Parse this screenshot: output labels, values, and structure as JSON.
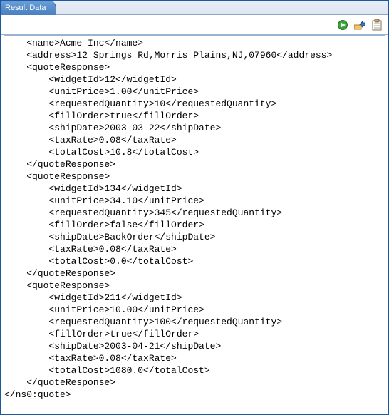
{
  "tab": {
    "title": "Result Data"
  },
  "toolbar": {
    "run": "run-icon",
    "export": "export-icon",
    "copy": "copy-icon"
  },
  "xml": {
    "indent1": "    ",
    "indent2": "        ",
    "name_open": "<name>",
    "name_val": "Acme Inc",
    "name_close": "</name>",
    "address_open": "<address>",
    "address_val": "12 Springs Rd,Morris Plains,NJ,07960",
    "address_close": "</address>",
    "qr_open": "<quoteResponse>",
    "qr_close": "</quoteResponse>",
    "widgetId_open": "<widgetId>",
    "widgetId_close": "</widgetId>",
    "unitPrice_open": "<unitPrice>",
    "unitPrice_close": "</unitPrice>",
    "reqQty_open": "<requestedQuantity>",
    "reqQty_close": "</requestedQuantity>",
    "fillOrder_open": "<fillOrder>",
    "fillOrder_close": "</fillOrder>",
    "shipDate_open": "<shipDate>",
    "shipDate_close": "</shipDate>",
    "taxRate_open": "<taxRate>",
    "taxRate_close": "</taxRate>",
    "totalCost_open": "<totalCost>",
    "totalCost_close": "</totalCost>",
    "ns_close": "</ns0:quote>",
    "responses": [
      {
        "widgetId": "12",
        "unitPrice": "1.00",
        "requestedQuantity": "10",
        "fillOrder": "true",
        "shipDate": "2003-03-22",
        "taxRate": "0.08",
        "totalCost": "10.8"
      },
      {
        "widgetId": "134",
        "unitPrice": "34.10",
        "requestedQuantity": "345",
        "fillOrder": "false",
        "shipDate": "BackOrder",
        "taxRate": "0.08",
        "totalCost": "0.0"
      },
      {
        "widgetId": "211",
        "unitPrice": "10.00",
        "requestedQuantity": "100",
        "fillOrder": "true",
        "shipDate": "2003-04-21",
        "taxRate": "0.08",
        "totalCost": "1080.0"
      }
    ]
  }
}
